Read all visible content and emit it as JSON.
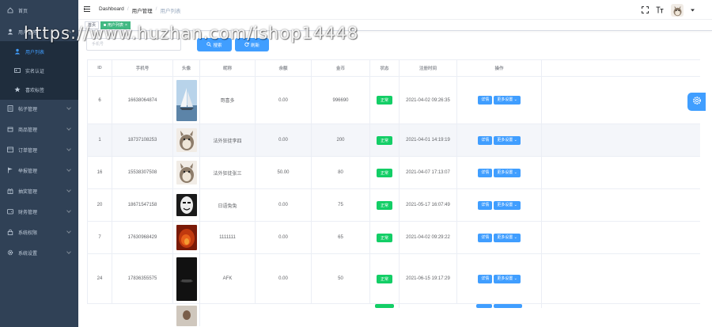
{
  "sidebar": {
    "items": [
      {
        "label": "首页",
        "icon": "home-icon"
      },
      {
        "label": "用户管理",
        "icon": "user-icon"
      },
      {
        "label": "用户列表",
        "icon": "user-icon"
      },
      {
        "label": "实名认证",
        "icon": "id-card-icon"
      },
      {
        "label": "喜欢标签",
        "icon": "star-icon"
      },
      {
        "label": "帖子管理",
        "icon": "document-icon"
      },
      {
        "label": "商品管理",
        "icon": "box-icon"
      },
      {
        "label": "订单管理",
        "icon": "order-icon"
      },
      {
        "label": "举报管理",
        "icon": "flag-icon"
      },
      {
        "label": "抽奖管理",
        "icon": "gift-icon"
      },
      {
        "label": "财务管理",
        "icon": "wallet-icon"
      },
      {
        "label": "系统权限",
        "icon": "lock-icon"
      },
      {
        "label": "系统设置",
        "icon": "gear-icon"
      }
    ]
  },
  "header": {
    "breadcrumb": [
      "Dashboard",
      "用户管理",
      "用户列表"
    ],
    "separator": "/"
  },
  "tags": {
    "home": "首页",
    "active": "用户列表",
    "close": "×"
  },
  "search": {
    "placeholder": "手机号",
    "search_label": "搜索",
    "refresh_label": "刷新"
  },
  "table": {
    "columns": [
      "ID",
      "手机号",
      "头像",
      "昵称",
      "余额",
      "金币",
      "状态",
      "注册时间",
      "操作"
    ],
    "status_label": "正常",
    "detail_label": "详情",
    "more_label": "更多设置",
    "rows": [
      {
        "id": "6",
        "phone": "16638064874",
        "avatar": "sailboat",
        "nickname": "哥喜多",
        "balance": "0.00",
        "coins": "996690",
        "time": "2021-04-02 09:26:35"
      },
      {
        "id": "1",
        "phone": "18737108253",
        "avatar": "totoro",
        "nickname": "法外狂徒李四",
        "balance": "0.00",
        "coins": "200",
        "time": "2021-04-01 14:19:19"
      },
      {
        "id": "16",
        "phone": "15538307508",
        "avatar": "totoro",
        "nickname": "法外狂徒张三",
        "balance": "50.00",
        "coins": "80",
        "time": "2021-04-07 17:13:07"
      },
      {
        "id": "20",
        "phone": "18671547158",
        "avatar": "face",
        "nickname": "日语兔兔",
        "balance": "0.00",
        "coins": "75",
        "time": "2021-05-17 16:07:49"
      },
      {
        "id": "7",
        "phone": "17630968429",
        "avatar": "fire",
        "nickname": "1111111",
        "balance": "0.00",
        "coins": "65",
        "time": "2021-04-02 09:29:22"
      },
      {
        "id": "24",
        "phone": "17836355575",
        "avatar": "dark",
        "nickname": "AFK",
        "balance": "0.00",
        "coins": "50",
        "time": "2021-06-15 19:17:29"
      }
    ]
  },
  "watermark": "https://www.huzhan.com/ishop14448",
  "colors": {
    "sidebar_bg": "#304156",
    "accent": "#409eff",
    "status_green": "#13ce66",
    "tag_green": "#42b983"
  }
}
